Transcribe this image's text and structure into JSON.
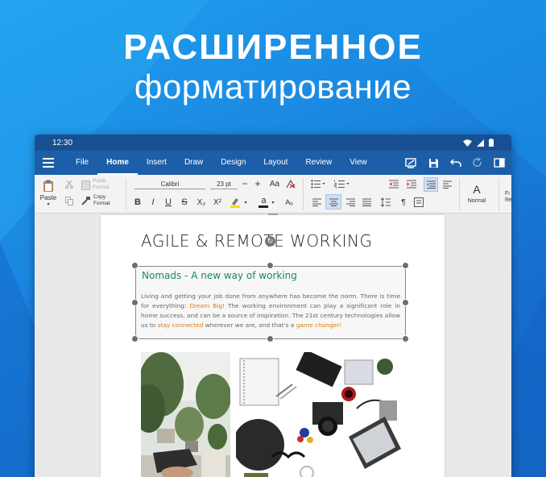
{
  "hero": {
    "line1": "РАСШИРЕННОЕ",
    "line2": "форматирование"
  },
  "status_bar": {
    "time": "12:30",
    "icons": [
      "wifi-icon",
      "signal-icon",
      "battery-icon"
    ]
  },
  "menu": {
    "tabs": [
      {
        "label": "File"
      },
      {
        "label": "Home",
        "active": true
      },
      {
        "label": "Insert"
      },
      {
        "label": "Draw"
      },
      {
        "label": "Design"
      },
      {
        "label": "Layout"
      },
      {
        "label": "Review"
      },
      {
        "label": "View"
      }
    ],
    "tools": [
      "presentation-mode-icon",
      "save-icon",
      "undo-icon",
      "redo-icon",
      "reading-mode-icon"
    ]
  },
  "ribbon": {
    "paste_label": "Paste",
    "paste_format_label": "Paste Format",
    "copy_format_label": "Copy Format",
    "font_name": "Calibri",
    "font_size": "23 pt",
    "style_label": "Normal",
    "style_letter": "A",
    "next_style_label": "Fi Re",
    "bold": "B",
    "italic": "I",
    "underline": "U",
    "strike": "S",
    "subscript": "X₂",
    "superscript": "X²",
    "grow_font": "Aa",
    "font_color_glyph": "a",
    "clear_format_glyph": "Aₒ",
    "colors": {
      "highlight": "#f5e000",
      "font_color": "#222222",
      "active_button": "#cfe0f5"
    }
  },
  "document": {
    "title": "AGILE & REMOTE WORKING",
    "textbox_heading": "Nomads - A new way of working",
    "body_parts": [
      {
        "text": "Living and getting your job done from anywhere has become the norm. There is time for everything: ",
        "highlight": false
      },
      {
        "text": "Dream Big!",
        "highlight": true
      },
      {
        "text": " The working environment can play a significant role in home success, and can be a source of inspiration. The 21st century technologies allow us to ",
        "highlight": false
      },
      {
        "text": "stay connected",
        "highlight": true
      },
      {
        "text": " wherever we are, and that's a ",
        "highlight": false
      },
      {
        "text": "game changer!",
        "highlight": true
      }
    ],
    "colors": {
      "heading": "#1a8a5c",
      "highlight": "#e07a10"
    }
  },
  "brand_colors": {
    "background": "#1b86df",
    "status_bar": "#184f93",
    "tab_bar": "#1d5ea8"
  }
}
